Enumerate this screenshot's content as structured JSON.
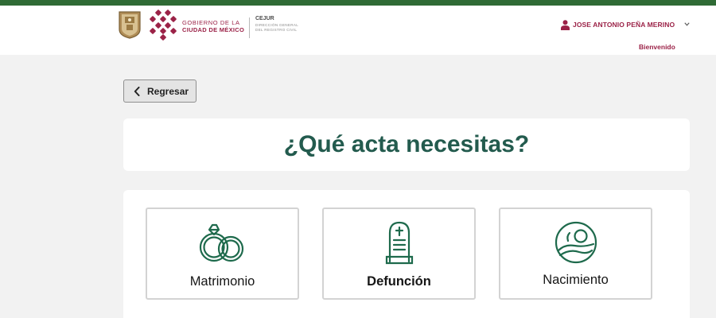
{
  "header": {
    "gov_line1": "GOBIERNO DE LA",
    "gov_line2": "CIUDAD DE MÉXICO",
    "cejur_title": "CEJUR",
    "cejur_sub1": "DIRECCIÓN GENERAL",
    "cejur_sub2": "DEL REGISTRO CIVIL",
    "user_name": "JOSE ANTONIO PEÑA MERINO",
    "welcome": "Bienvenido"
  },
  "back_button": {
    "label": "Regresar"
  },
  "main": {
    "title": "¿Qué acta necesitas?",
    "options": [
      {
        "label": "Matrimonio",
        "icon": "wedding-rings-icon"
      },
      {
        "label": "Defunción",
        "icon": "tombstone-icon"
      },
      {
        "label": "Nacimiento",
        "icon": "newborn-icon"
      }
    ]
  },
  "colors": {
    "top_bar": "#2f6b35",
    "brand_red": "#9b2247",
    "brand_green": "#235b4e",
    "icon_green": "#1e6a4c"
  }
}
